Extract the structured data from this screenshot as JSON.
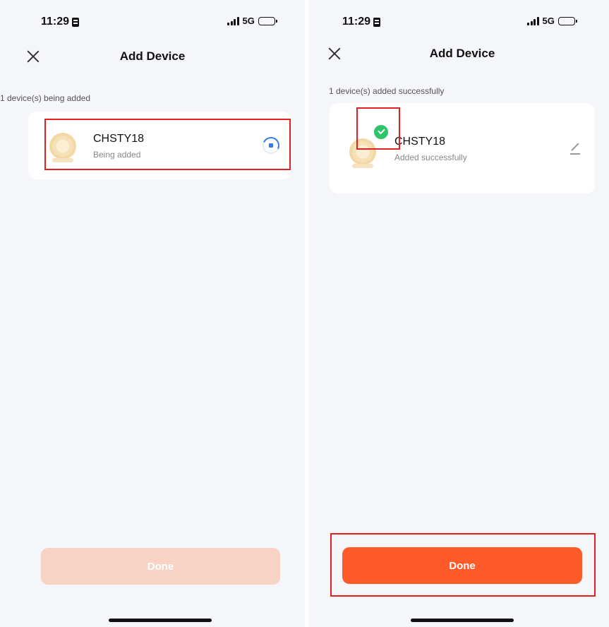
{
  "left": {
    "status": {
      "time": "11:29",
      "network": "5G"
    },
    "nav": {
      "title": "Add Device"
    },
    "section_label": "1 device(s) being added",
    "device": {
      "name": "CHSTY18",
      "status": "Being added"
    },
    "done_label": "Done"
  },
  "right": {
    "status": {
      "time": "11:29",
      "network": "5G"
    },
    "nav": {
      "title": "Add Device"
    },
    "section_label": "1 device(s) added successfully",
    "device": {
      "name": "CHSTY18",
      "status": "Added successfully"
    },
    "done_label": "Done"
  },
  "colors": {
    "accent": "#ff5a29",
    "accent_disabled": "#f7d3c6",
    "success": "#2fc36a",
    "progress": "#2f7cf0",
    "highlight": "#e41f1f",
    "background": "#f5f6fa"
  },
  "icons": [
    "close-icon",
    "spinner-icon",
    "check-icon",
    "edit-icon",
    "signal-icon",
    "battery-icon",
    "sim-icon"
  ]
}
